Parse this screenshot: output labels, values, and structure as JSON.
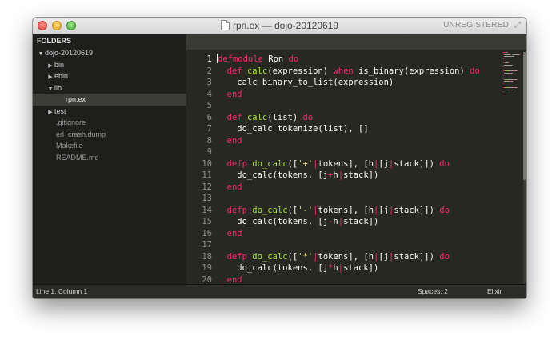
{
  "window": {
    "title": "rpn.ex — dojo-20120619",
    "unregistered": "UNREGISTERED"
  },
  "sidebar": {
    "header": "FOLDERS",
    "items": [
      {
        "label": "dojo-20120619",
        "kind": "folder",
        "expanded": true,
        "depth": 0
      },
      {
        "label": "bin",
        "kind": "folder",
        "expanded": false,
        "depth": 1
      },
      {
        "label": "ebin",
        "kind": "folder",
        "expanded": false,
        "depth": 1
      },
      {
        "label": "lib",
        "kind": "folder",
        "expanded": true,
        "depth": 1
      },
      {
        "label": "rpn.ex",
        "kind": "file",
        "selected": true,
        "depth": 3
      },
      {
        "label": "test",
        "kind": "folder",
        "expanded": false,
        "depth": 1
      },
      {
        "label": ".gitignore",
        "kind": "file",
        "depth": 2
      },
      {
        "label": "erl_crash.dump",
        "kind": "file",
        "depth": 2
      },
      {
        "label": "Makefile",
        "kind": "file",
        "depth": 2
      },
      {
        "label": "README.md",
        "kind": "file",
        "depth": 2
      }
    ]
  },
  "editor": {
    "line_numbers": [
      "1",
      "2",
      "3",
      "4",
      "5",
      "6",
      "7",
      "8",
      "9",
      "10",
      "11",
      "12",
      "13",
      "14",
      "15",
      "16",
      "17",
      "18",
      "19",
      "20"
    ],
    "active_line": 1,
    "lines": [
      [
        [
          "kw",
          "defmodule"
        ],
        [
          "t",
          " Rpn "
        ],
        [
          "kw",
          "do"
        ]
      ],
      [
        [
          "t",
          "  "
        ],
        [
          "kw",
          "def"
        ],
        [
          "t",
          " "
        ],
        [
          "fn",
          "calc"
        ],
        [
          "t",
          "(expression) "
        ],
        [
          "kw",
          "when"
        ],
        [
          "t",
          " is_binary(expression) "
        ],
        [
          "kw",
          "do"
        ]
      ],
      [
        [
          "t",
          "    calc binary_to_list(expression)"
        ]
      ],
      [
        [
          "t",
          "  "
        ],
        [
          "kw",
          "end"
        ]
      ],
      [
        [
          "t",
          ""
        ]
      ],
      [
        [
          "t",
          "  "
        ],
        [
          "kw",
          "def"
        ],
        [
          "t",
          " "
        ],
        [
          "fn",
          "calc"
        ],
        [
          "t",
          "(list) "
        ],
        [
          "kw",
          "do"
        ]
      ],
      [
        [
          "t",
          "    do_calc tokenize(list), []"
        ]
      ],
      [
        [
          "t",
          "  "
        ],
        [
          "kw",
          "end"
        ]
      ],
      [
        [
          "t",
          ""
        ]
      ],
      [
        [
          "t",
          "  "
        ],
        [
          "kw",
          "defp"
        ],
        [
          "t",
          " "
        ],
        [
          "fn",
          "do_calc"
        ],
        [
          "t",
          "(["
        ],
        [
          "st",
          "'+'"
        ],
        [
          "op",
          "|"
        ],
        [
          "t",
          "tokens], [h"
        ],
        [
          "op",
          "|"
        ],
        [
          "t",
          "[j"
        ],
        [
          "op",
          "|"
        ],
        [
          "t",
          "stack]]) "
        ],
        [
          "kw",
          "do"
        ]
      ],
      [
        [
          "t",
          "    do_calc(tokens, [j"
        ],
        [
          "op",
          "+"
        ],
        [
          "t",
          "h"
        ],
        [
          "op",
          "|"
        ],
        [
          "t",
          "stack])"
        ]
      ],
      [
        [
          "t",
          "  "
        ],
        [
          "kw",
          "end"
        ]
      ],
      [
        [
          "t",
          ""
        ]
      ],
      [
        [
          "t",
          "  "
        ],
        [
          "kw",
          "defp"
        ],
        [
          "t",
          " "
        ],
        [
          "fn",
          "do_calc"
        ],
        [
          "t",
          "(["
        ],
        [
          "st",
          "'-'"
        ],
        [
          "op",
          "|"
        ],
        [
          "t",
          "tokens], [h"
        ],
        [
          "op",
          "|"
        ],
        [
          "t",
          "[j"
        ],
        [
          "op",
          "|"
        ],
        [
          "t",
          "stack]]) "
        ],
        [
          "kw",
          "do"
        ]
      ],
      [
        [
          "t",
          "    do_calc(tokens, [j"
        ],
        [
          "op",
          "-"
        ],
        [
          "t",
          "h"
        ],
        [
          "op",
          "|"
        ],
        [
          "t",
          "stack])"
        ]
      ],
      [
        [
          "t",
          "  "
        ],
        [
          "kw",
          "end"
        ]
      ],
      [
        [
          "t",
          ""
        ]
      ],
      [
        [
          "t",
          "  "
        ],
        [
          "kw",
          "defp"
        ],
        [
          "t",
          " "
        ],
        [
          "fn",
          "do_calc"
        ],
        [
          "t",
          "(["
        ],
        [
          "st",
          "'*'"
        ],
        [
          "op",
          "|"
        ],
        [
          "t",
          "tokens], [h"
        ],
        [
          "op",
          "|"
        ],
        [
          "t",
          "[j"
        ],
        [
          "op",
          "|"
        ],
        [
          "t",
          "stack]]) "
        ],
        [
          "kw",
          "do"
        ]
      ],
      [
        [
          "t",
          "    do_calc(tokens, [j"
        ],
        [
          "op",
          "*"
        ],
        [
          "t",
          "h"
        ],
        [
          "op",
          "|"
        ],
        [
          "t",
          "stack])"
        ]
      ],
      [
        [
          "t",
          "  "
        ],
        [
          "kw",
          "end"
        ]
      ]
    ]
  },
  "statusbar": {
    "position": "Line 1, Column 1",
    "spaces": "Spaces: 2",
    "syntax": "Elixir"
  },
  "colors": {
    "background": "#272822",
    "keyword": "#f92672",
    "function": "#a6e22e",
    "string": "#e6db74",
    "text": "#f8f8f2",
    "gutter": "#8f908a",
    "sidebar": "#1e1f1c"
  }
}
